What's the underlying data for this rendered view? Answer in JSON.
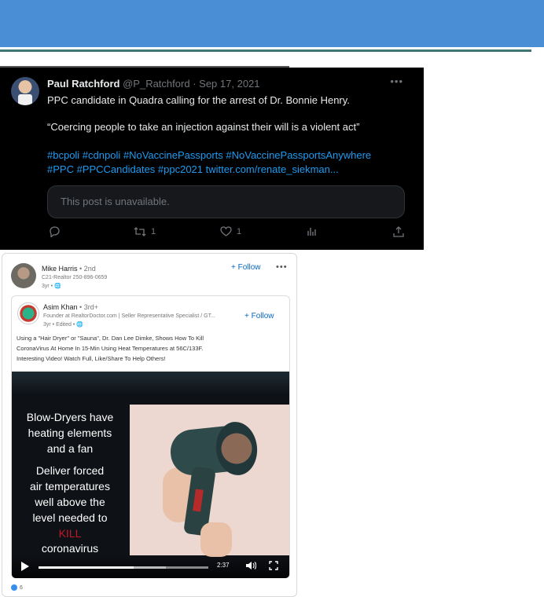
{
  "colors": {
    "banner": "#4a8fd6",
    "tweet_bg": "#000000",
    "tweet_link": "#1d9bf0",
    "linkedin_blue": "#0a66c2",
    "kill_red": "#c4172c"
  },
  "tweet": {
    "author_name": "Paul Ratchford",
    "handle": "@P_Ratchford",
    "separator": "·",
    "date": "Sep 17, 2021",
    "more_label": "•••",
    "line1": "PPC candidate in Quadra calling for the arrest of Dr. Bonnie Henry.",
    "line2": "“Coercing people to take an injection against their will is a violent act”",
    "hashtags_line1": "#bcpoli #cdnpoli #NoVaccinePassports #NoVaccinePassportsAnywhere",
    "hashtags_line2": "#PPC #PPCCandidates #ppc2021 twitter.com/renate_siekman...",
    "quoted_post_text": "This post is unavailable.",
    "actions": {
      "reply_icon": "reply-icon",
      "retweet_icon": "retweet-icon",
      "retweet_count": "1",
      "like_icon": "heart-icon",
      "like_count": "1",
      "views_icon": "analytics-icon",
      "share_icon": "share-icon"
    }
  },
  "linkedin": {
    "sharer": {
      "name": "Mike Harris",
      "degree": "• 2nd",
      "headline": "C21-Realtor 250-896-0659",
      "time": "3yr • 🌐",
      "follow_label": "+ Follow",
      "more_label": "•••"
    },
    "original": {
      "name": "Asim Khan",
      "degree": "• 3rd+",
      "headline": "Founder at RealtorDoctor.com | Seller Representative Specialist / GT...",
      "time": "3yr • Edited • 🌐",
      "follow_label": "+ Follow",
      "body_line1": "Using a \"Hair Dryer\" or \"Sauna\", Dr. Dan Lee Dimke, Shows How To Kill",
      "body_line2": "CoronaVirus At Home In 15-Min Using Heat Temperatures at 56C/133F.",
      "body_line3": "Interesting Video! Watch Full, Like/Share To Help Others!"
    },
    "video": {
      "caption_lines": [
        "Blow-Dryers have",
        "heating elements",
        "and a fan",
        "Deliver forced",
        "air temperatures",
        "well above the",
        "level needed to",
        "KILL",
        "coronavirus"
      ],
      "time": "2:37",
      "progress_fraction": 0.56,
      "buffered_fraction": 0.75
    },
    "reactions_count": "6"
  }
}
